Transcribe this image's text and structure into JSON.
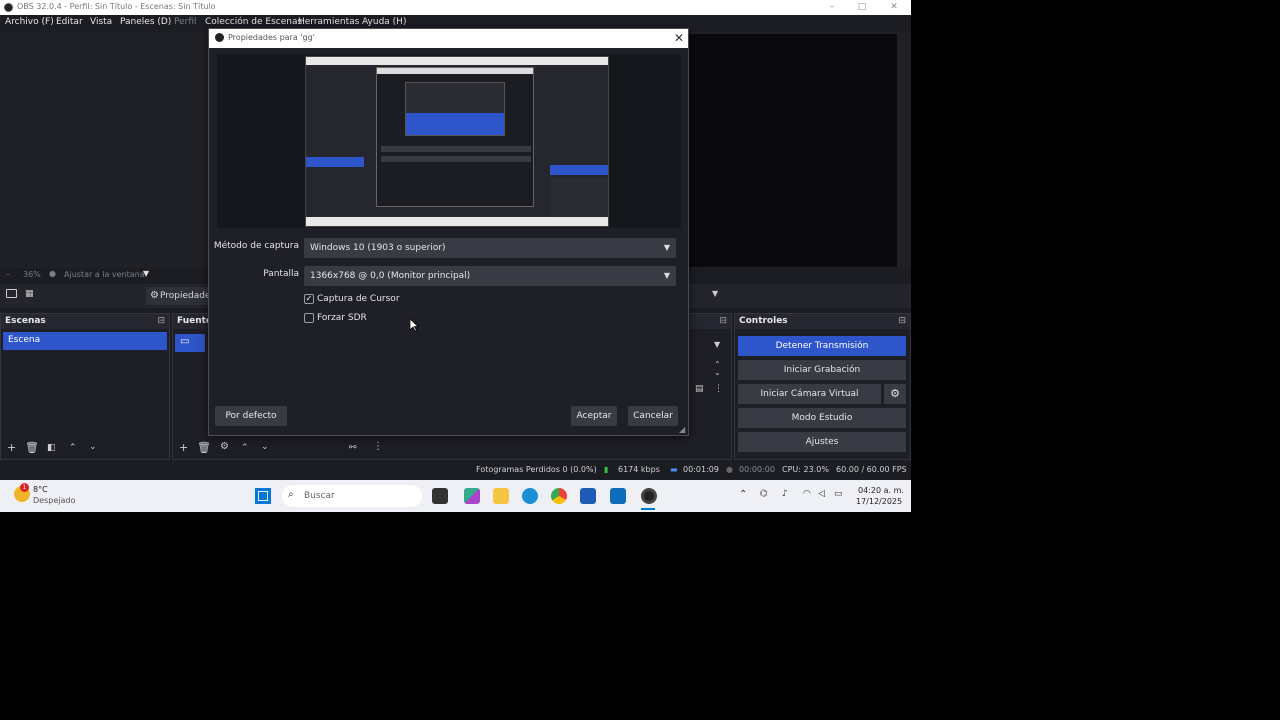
{
  "window": {
    "title": "OBS 32.0.4 - Perfil: Sin Título - Escenas: Sin Título",
    "controls": [
      "–",
      "□",
      "✕"
    ]
  },
  "menu": [
    {
      "label": "Archivo (F)",
      "enabled": true
    },
    {
      "label": "Editar",
      "enabled": true
    },
    {
      "label": "Vista",
      "enabled": true
    },
    {
      "label": "Paneles (D)",
      "enabled": true
    },
    {
      "label": "Perfil",
      "enabled": false
    },
    {
      "label": "Colección de Escenas",
      "enabled": true
    },
    {
      "label": "Herramientas",
      "enabled": true
    },
    {
      "label": "Ayuda (H)",
      "enabled": true
    }
  ],
  "zoom": {
    "value": "36%",
    "fit_label": "Ajustar a la ventana"
  },
  "toolbar": {
    "properties_label": "Propiedades"
  },
  "scenes": {
    "title": "Escenas",
    "items": [
      "Escena"
    ],
    "selected": 0
  },
  "sources": {
    "title": "Fuentes"
  },
  "controls": {
    "title": "Controles",
    "stop_stream": "Detener Transmisión",
    "start_record": "Iniciar Grabación",
    "start_virtual_cam": "Iniciar Cámara Virtual",
    "studio_mode": "Modo Estudio",
    "settings": "Ajustes"
  },
  "status": {
    "dropped": "Fotogramas Perdidos 0 (0.0%)",
    "bitrate": "6174 kbps",
    "stream_time": "00:01:09",
    "rec_time": "00:00:00",
    "cpu": "CPU: 23.0%",
    "fps": "60.00 / 60.00 FPS"
  },
  "dialog": {
    "title": "Propiedades para 'gg'",
    "capture_method_label": "Método de captura",
    "capture_method_value": "Windows 10 (1903 o superior)",
    "display_label": "Pantalla",
    "display_value": "1366x768 @ 0,0 (Monitor principal)",
    "cursor_label": "Captura de Cursor",
    "cursor_checked": true,
    "sdr_label": "Forzar SDR",
    "sdr_checked": false,
    "defaults_button": "Por defecto",
    "ok_button": "Aceptar",
    "cancel_button": "Cancelar"
  },
  "taskbar": {
    "weather_temp": "8°C",
    "weather_desc": "Despejado",
    "search_placeholder": "Buscar",
    "time": "04:20 a. m.",
    "date": "17/12/2025"
  },
  "colors": {
    "accent": "#2e55c9",
    "background": "#1c1d23",
    "button": "#383a44"
  }
}
